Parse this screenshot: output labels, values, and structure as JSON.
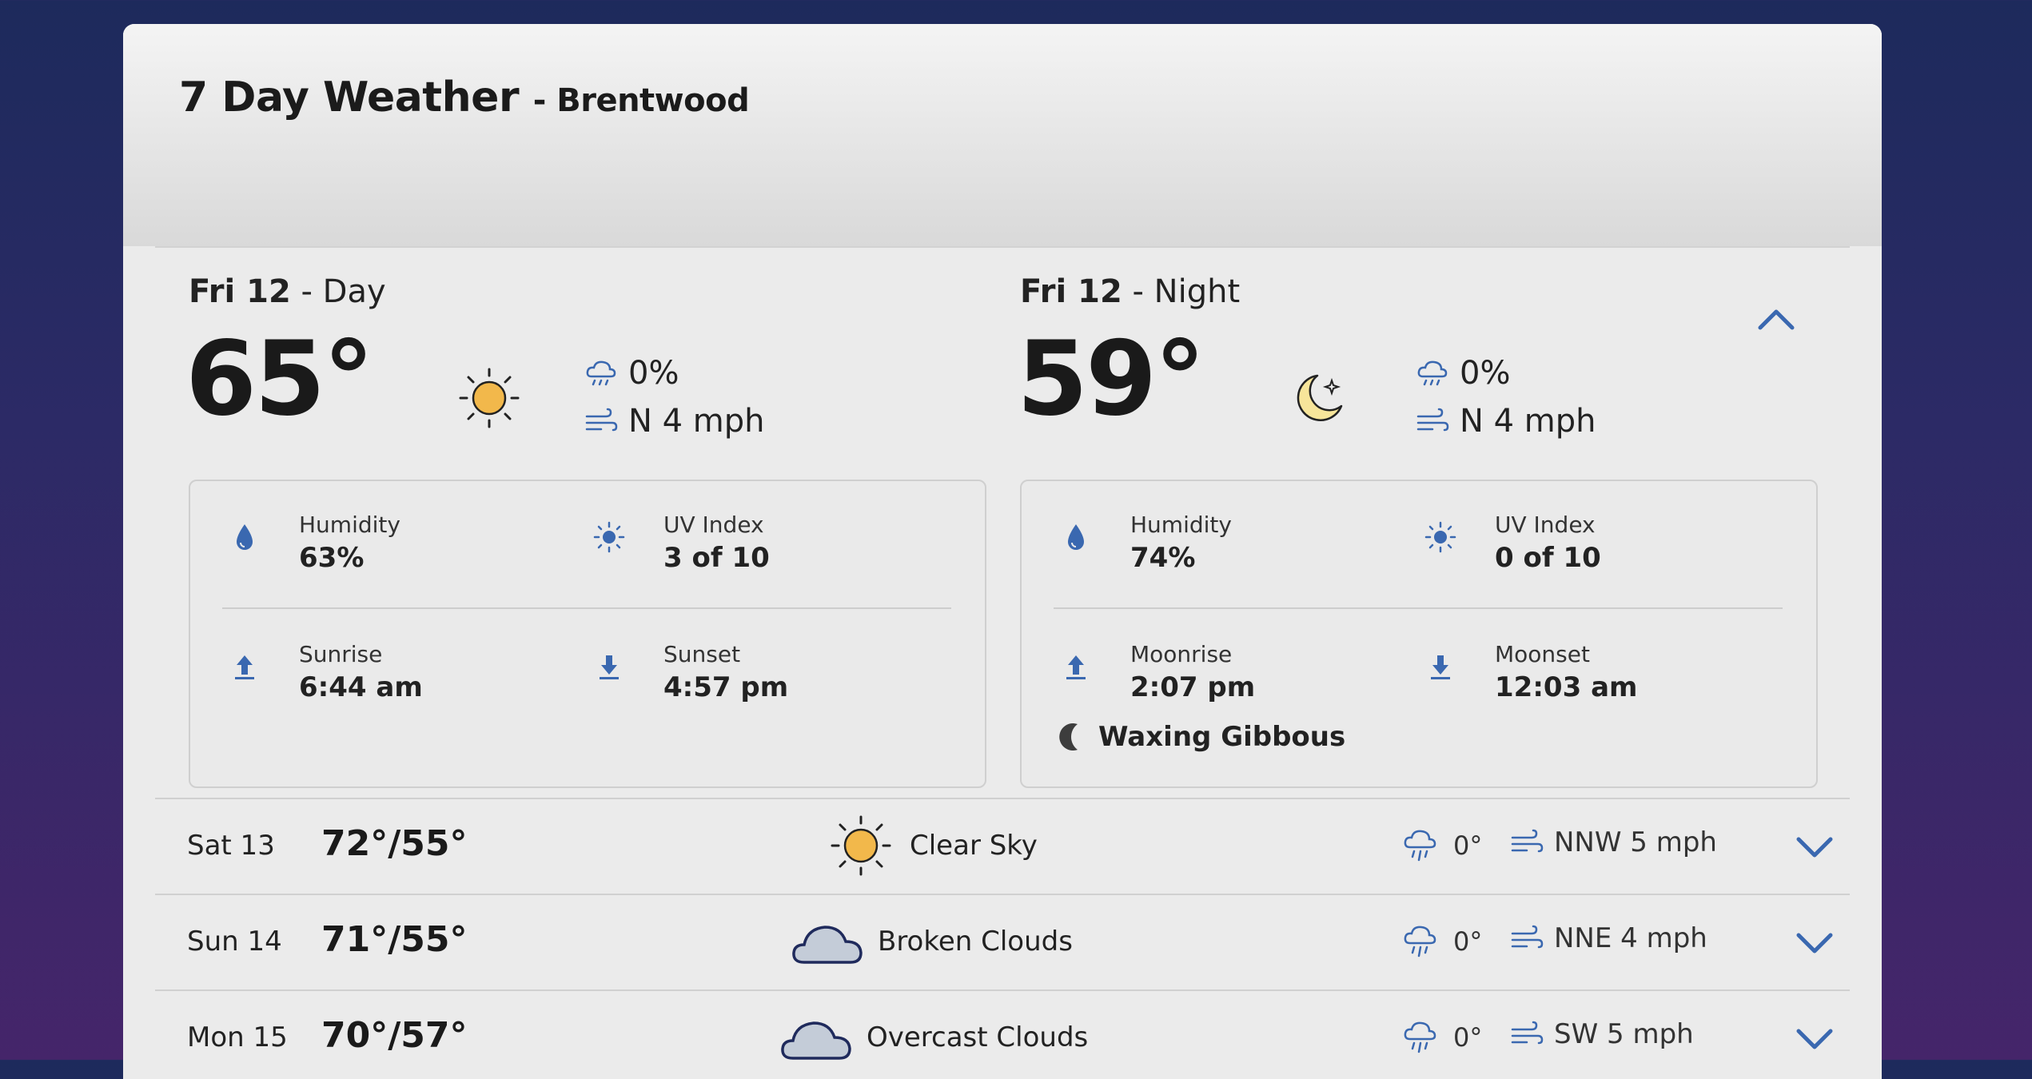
{
  "header": {
    "title": "7 Day Weather",
    "location": "- Brentwood"
  },
  "today": {
    "day": {
      "label": "Fri 12",
      "period": "- Day",
      "temp": "65°",
      "icon": "sun-icon",
      "precip": "0%",
      "wind": "N 4 mph",
      "humidity_label": "Humidity",
      "humidity": "63%",
      "uv_label": "UV Index",
      "uv": "3 of 10",
      "rise_label": "Sunrise",
      "rise": "6:44 am",
      "set_label": "Sunset",
      "set": "4:57 pm"
    },
    "night": {
      "label": "Fri 12",
      "period": "- Night",
      "temp": "59°",
      "icon": "moon-icon",
      "precip": "0%",
      "wind": "N 4 mph",
      "humidity_label": "Humidity",
      "humidity": "74%",
      "uv_label": "UV Index",
      "uv": "0 of 10",
      "rise_label": "Moonrise",
      "rise": "2:07 pm",
      "set_label": "Moonset",
      "set": "12:03 am",
      "moon_phase": "Waxing Gibbous"
    }
  },
  "forecast": [
    {
      "day": "Sat 13",
      "hilo": "72°/55°",
      "condition": "Clear Sky",
      "icon": "sun-icon",
      "precip": "0°",
      "wind": "NNW 5 mph"
    },
    {
      "day": "Sun 14",
      "hilo": "71°/55°",
      "condition": "Broken Clouds",
      "icon": "cloud-icon",
      "precip": "0°",
      "wind": "NNE 4 mph"
    },
    {
      "day": "Mon 15",
      "hilo": "70°/57°",
      "condition": "Overcast Clouds",
      "icon": "cloud-icon",
      "precip": "0°",
      "wind": "SW 5 mph"
    }
  ],
  "colors": {
    "accent": "#3a68b0",
    "sun": "#f2b84b",
    "moon": "#f7e59a",
    "cloud": "#c4ccd8"
  }
}
